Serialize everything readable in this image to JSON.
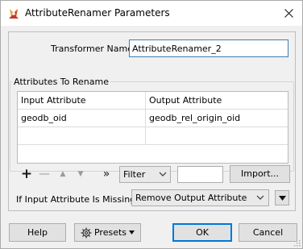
{
  "window": {
    "title": "AttributeRenamer Parameters"
  },
  "form": {
    "transformer_name_label": "Transformer Name:",
    "transformer_name_value": "AttributeRenamer_2"
  },
  "attributes": {
    "group_title": "Attributes To Rename",
    "columns": [
      "Input Attribute",
      "Output Attribute"
    ],
    "rows": [
      {
        "input": "geodb_oid",
        "output": "geodb_rel_origin_oid"
      },
      {
        "input": "",
        "output": ""
      }
    ]
  },
  "toolbar": {
    "add_glyph": "+",
    "remove_glyph": "—",
    "move_up_glyph": "▲",
    "move_down_glyph": "▼",
    "expand_glyph": "»",
    "filter_label": "Filter",
    "filter_text": "",
    "import_label": "Import..."
  },
  "missing": {
    "label": "If Input Attribute Is Missing:",
    "value": "Remove Output Attribute"
  },
  "buttons": {
    "help": "Help",
    "presets": "Presets",
    "ok": "OK",
    "cancel": "Cancel"
  },
  "colors": {
    "focus_border": "#3c7fb1",
    "ok_border": "#0078d7",
    "app_icon": "#d04a1f"
  },
  "icons": {
    "app": "fme-transformer-icon",
    "close": "close-icon",
    "presets": "gear-icon"
  }
}
